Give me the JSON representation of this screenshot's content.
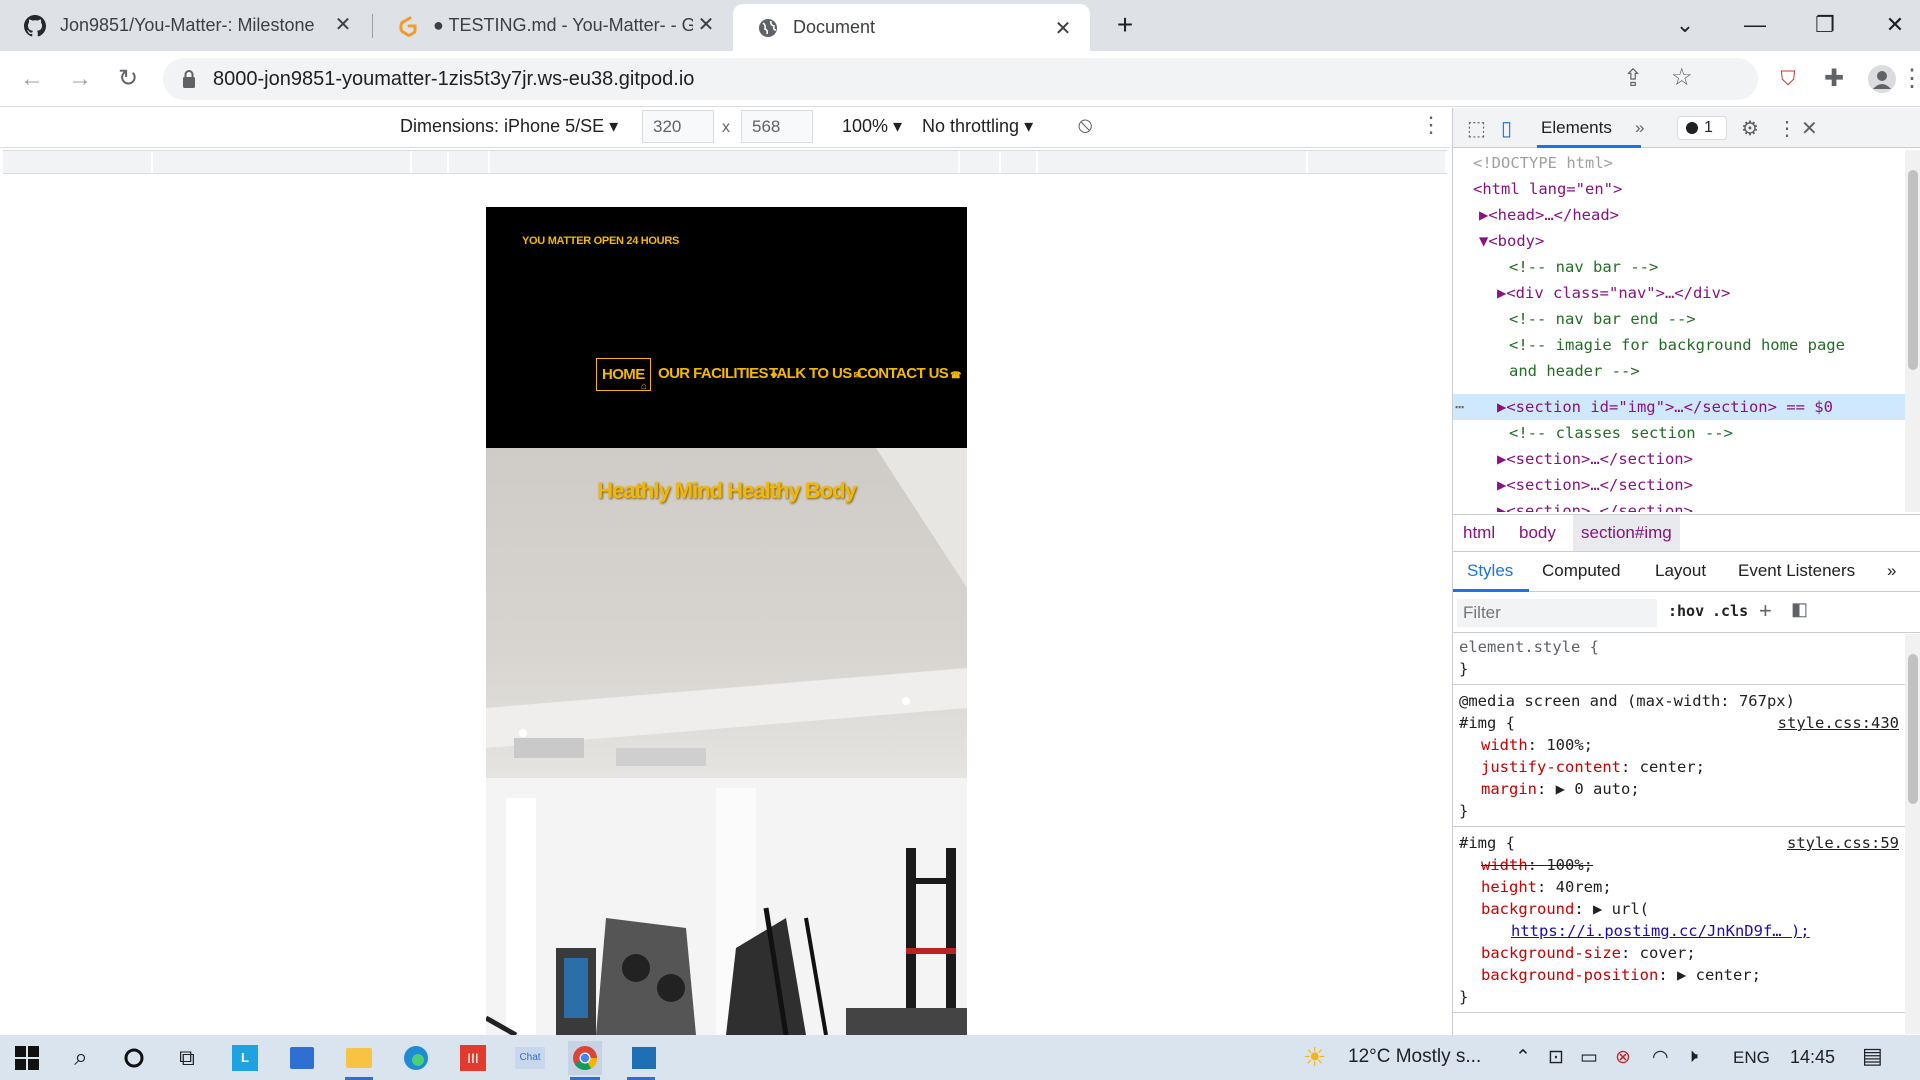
{
  "browser": {
    "tabs": [
      {
        "title": "Jon9851/You-Matter-: Milestone",
        "icon": "github-icon",
        "active": false
      },
      {
        "title": "● TESTING.md - You-Matter- - Gi",
        "icon": "gitpod-icon",
        "active": false
      },
      {
        "title": "Document",
        "icon": "globe-icon",
        "active": true
      }
    ],
    "new_tab_label": "+",
    "url": "8000-jon9851-youmatter-1zis5t3y7jr.ws-eu38.gitpod.io"
  },
  "device_toolbar": {
    "device_label": "Dimensions: iPhone 5/SE",
    "width_value": "320",
    "height_value": "568",
    "times": "x",
    "zoom": "100%",
    "throttling": "No throttling"
  },
  "site": {
    "logo": "YOU MATTER OPEN 24 HOURS",
    "nav": [
      "HOME",
      "OUR FACILITIES",
      "TALK TO US",
      "CONTACT US"
    ],
    "hero_title": "Heathly Mind Healthy Body"
  },
  "devtools": {
    "panel_tab": "Elements",
    "error_count": "1",
    "dom_lines": [
      {
        "indent": 0,
        "text": "<!DOCTYPE html>",
        "kind": "grey"
      },
      {
        "indent": 0,
        "text": "<html lang=\"en\">",
        "kind": "tag"
      },
      {
        "indent": 1,
        "text": "▶<head>…</head>",
        "kind": "tag"
      },
      {
        "indent": 1,
        "text": "▼<body>",
        "kind": "tag"
      },
      {
        "indent": 2,
        "text": "<!-- nav bar -->",
        "kind": "cmt"
      },
      {
        "indent": 2,
        "text": "▶<div class=\"nav\">…</div>",
        "kind": "tag"
      },
      {
        "indent": 2,
        "text": "<!-- nav bar end  -->",
        "kind": "cmt"
      },
      {
        "indent": 2,
        "text": "<!-- imagie for background home page",
        "kind": "cmt"
      },
      {
        "indent": 2,
        "text": "and header  -->",
        "kind": "cmt"
      },
      {
        "indent": 2,
        "text": "▶<section id=\"img\">…</section> == $0",
        "kind": "tag"
      },
      {
        "indent": 2,
        "text": "<!-- classes section -->",
        "kind": "cmt"
      },
      {
        "indent": 2,
        "text": "▶<section>…</section>",
        "kind": "tag"
      },
      {
        "indent": 2,
        "text": "▶<section>…</section>",
        "kind": "tag"
      },
      {
        "indent": 2,
        "text": "▶<section>…</section>",
        "kind": "tag"
      }
    ],
    "breadcrumbs": [
      "html",
      "body",
      "section#img"
    ],
    "style_tabs": [
      "Styles",
      "Computed",
      "Layout",
      "Event Listeners"
    ],
    "filter_placeholder": "Filter",
    "hov": ":hov",
    "cls": ".cls",
    "styles": {
      "element_style": "element.style {",
      "close_brace": "}",
      "media": "@media screen and (max-width: 767px)",
      "rule1_selector": "#img {",
      "rule1_source": "style.css:430",
      "rule1_props": [
        {
          "name": "width",
          "value": "100%;"
        },
        {
          "name": "justify-content",
          "value": "center;"
        },
        {
          "name": "margin",
          "value": "▶ 0 auto;"
        }
      ],
      "rule2_selector": "#img {",
      "rule2_source": "style.css:59",
      "rule2_props": [
        {
          "name": "width",
          "value": "100%;",
          "struck": true
        },
        {
          "name": "height",
          "value": "40rem;"
        },
        {
          "name": "background",
          "value": "▶ url("
        },
        {
          "name": "",
          "value": "https://i.postimg.cc/JnKnD9f… );",
          "link": true
        },
        {
          "name": "background-size",
          "value": "cover;"
        },
        {
          "name": "background-position",
          "value": "▶ center;"
        }
      ]
    }
  },
  "taskbar": {
    "weather": "12°C  Mostly s...",
    "lang": "ENG",
    "time": "14:45",
    "chat_label": "Chat"
  },
  "colors": {
    "accent_yellow": "#f5b800",
    "nav_bg": "#000000",
    "selection": "#cfe8fc"
  }
}
